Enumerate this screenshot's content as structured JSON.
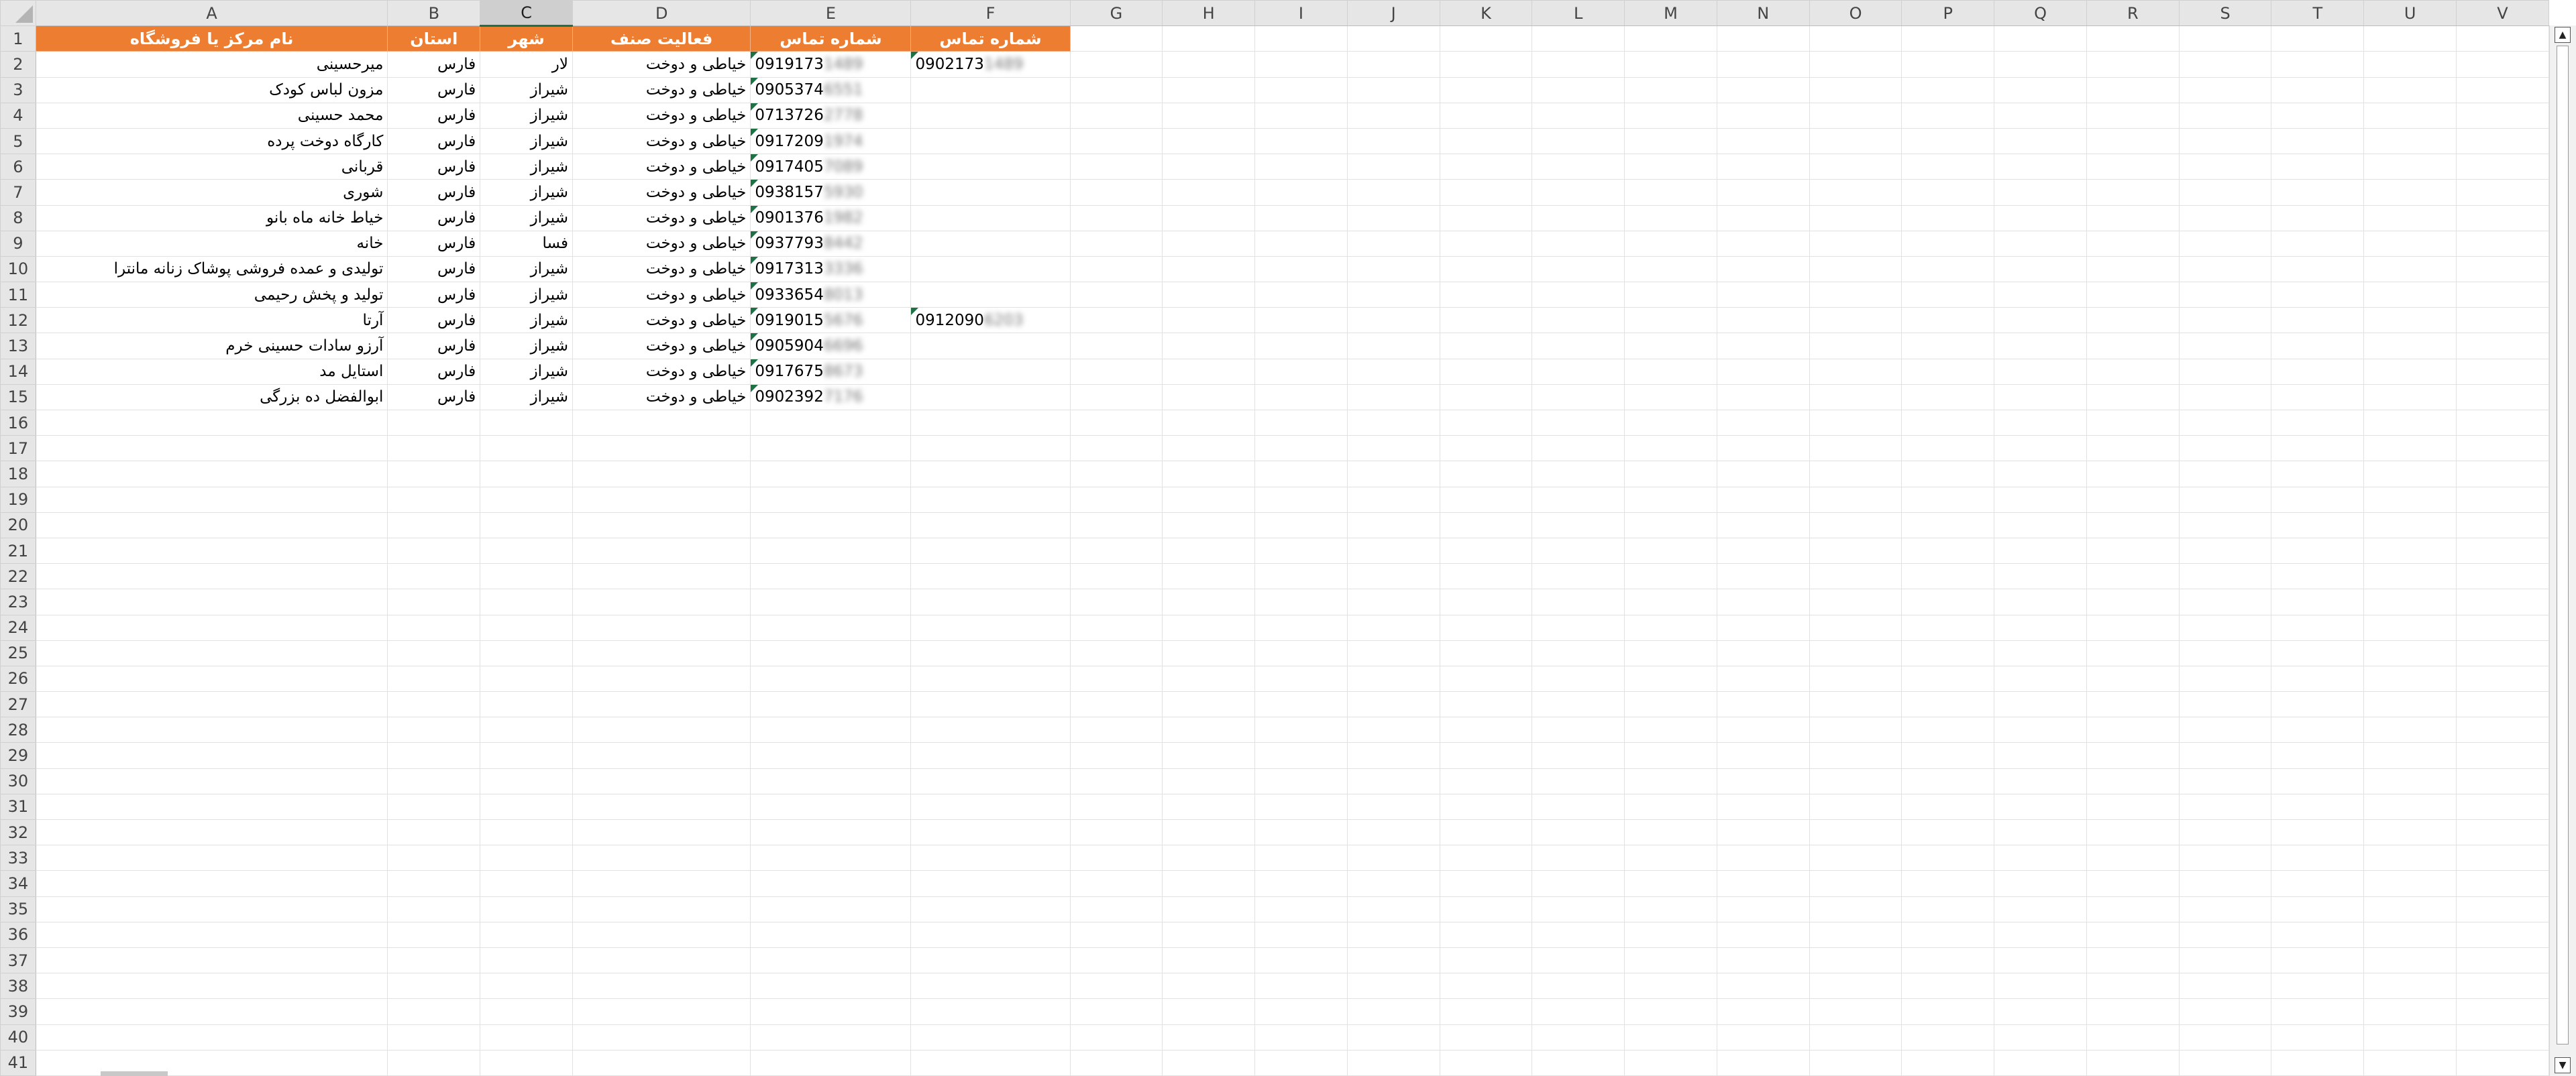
{
  "columns": [
    "A",
    "B",
    "C",
    "D",
    "E",
    "F",
    "G",
    "H",
    "I",
    "J",
    "K",
    "L",
    "M",
    "N",
    "O",
    "P",
    "Q",
    "R",
    "S",
    "T",
    "U",
    "V"
  ],
  "selected_column": "C",
  "total_rows": 41,
  "header_row": {
    "store_name": "نام مرکز یا فروشگاه",
    "province": "استان",
    "city": "شهر",
    "activity": "فعالیت صنف",
    "phone": "شماره تماس",
    "phone2": "شماره تماس"
  },
  "rows": [
    {
      "name": "میرحسینی",
      "province": "فارس",
      "city": "لار",
      "activity": "خیاطی و دوخت",
      "phone": "0919173",
      "phone_blur": "1489",
      "phone2": "0902173",
      "phone2_blur": "1489"
    },
    {
      "name": "مزون لباس کودک",
      "province": "فارس",
      "city": "شیراز",
      "activity": "خیاطی و دوخت",
      "phone": "0905374",
      "phone_blur": "6551",
      "phone2": "",
      "phone2_blur": ""
    },
    {
      "name": "محمد حسینی",
      "province": "فارس",
      "city": "شیراز",
      "activity": "خیاطی و دوخت",
      "phone": "0713726",
      "phone_blur": "2778",
      "phone2": "",
      "phone2_blur": ""
    },
    {
      "name": "کارگاه دوخت پرده",
      "province": "فارس",
      "city": "شیراز",
      "activity": "خیاطی و دوخت",
      "phone": "0917209",
      "phone_blur": "1974",
      "phone2": "",
      "phone2_blur": ""
    },
    {
      "name": "قربانی",
      "province": "فارس",
      "city": "شیراز",
      "activity": "خیاطی و دوخت",
      "phone": "0917405",
      "phone_blur": "7089",
      "phone2": "",
      "phone2_blur": ""
    },
    {
      "name": "شوری",
      "province": "فارس",
      "city": "شیراز",
      "activity": "خیاطی و دوخت",
      "phone": "0938157",
      "phone_blur": "5930",
      "phone2": "",
      "phone2_blur": ""
    },
    {
      "name": "خیاط خانه ماه بانو",
      "province": "فارس",
      "city": "شیراز",
      "activity": "خیاطی و دوخت",
      "phone": "0901376",
      "phone_blur": "1982",
      "phone2": "",
      "phone2_blur": ""
    },
    {
      "name": "خانه",
      "province": "فارس",
      "city": "فسا",
      "activity": "خیاطی و دوخت",
      "phone": "0937793",
      "phone_blur": "8442",
      "phone2": "",
      "phone2_blur": ""
    },
    {
      "name": "تولیدی و عمده فروشی پوشاک زنانه مانترا",
      "province": "فارس",
      "city": "شیراز",
      "activity": "خیاطی و دوخت",
      "phone": "0917313",
      "phone_blur": "3336",
      "phone2": "",
      "phone2_blur": ""
    },
    {
      "name": "تولید و پخش رحیمی",
      "province": "فارس",
      "city": "شیراز",
      "activity": "خیاطی و دوخت",
      "phone": "0933654",
      "phone_blur": "8013",
      "phone2": "",
      "phone2_blur": ""
    },
    {
      "name": "آرتا",
      "province": "فارس",
      "city": "شیراز",
      "activity": "خیاطی و دوخت",
      "phone": "0919015",
      "phone_blur": "5676",
      "phone2": "0912090",
      "phone2_blur": "6203"
    },
    {
      "name": "آرزو سادات حسینی خرم",
      "province": "فارس",
      "city": "شیراز",
      "activity": "خیاطی و دوخت",
      "phone": "0905904",
      "phone_blur": "6696",
      "phone2": "",
      "phone2_blur": ""
    },
    {
      "name": "استایل مد",
      "province": "فارس",
      "city": "شیراز",
      "activity": "خیاطی و دوخت",
      "phone": "0917675",
      "phone_blur": "8673",
      "phone2": "",
      "phone2_blur": ""
    },
    {
      "name": "ابوالفضل ده بزرگی",
      "province": "فارس",
      "city": "شیراز",
      "activity": "خیاطی و دوخت",
      "phone": "0902392",
      "phone_blur": "7176",
      "phone2": "",
      "phone2_blur": ""
    }
  ],
  "colors": {
    "header_fill": "#ed7d31",
    "header_text": "#ffffff",
    "gridline": "#e1e1e1",
    "headers_bg": "#e6e6e6",
    "selection_accent": "#1e7145"
  },
  "icons": {
    "scroll_up": "▲",
    "scroll_down": "▼"
  }
}
